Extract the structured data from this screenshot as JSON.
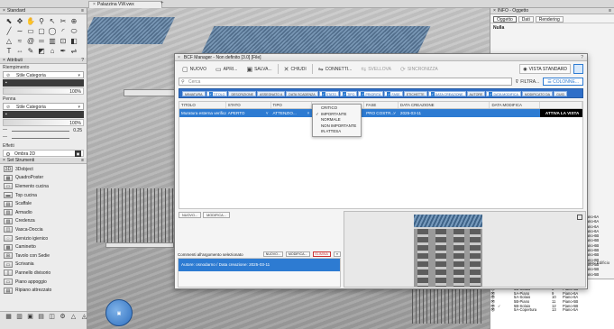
{
  "top": {
    "doc_tab_title": "Palazzina VW.vwx",
    "doc_tab_close": "×",
    "add_tab": "+"
  },
  "left": {
    "standard": {
      "title": "Standard"
    },
    "tools_row_icons": [
      "arrow-icon",
      "move-icon",
      "pan-icon",
      "zoom-icon",
      "flyover-icon",
      "close-icon",
      "3d-icon"
    ],
    "attributes": {
      "title": "Attributi",
      "fill_label": "Riempimento",
      "fill_value": "Stile Categoria",
      "percent_a": "100%",
      "pen_label": "Penna",
      "pen_value": "Stile Categoria",
      "percent_b": "100%",
      "thickness": "0.25",
      "effects_label": "Effetti",
      "shadow_label": "Ombra 2D"
    },
    "set_tools": {
      "title": "Set Strumenti",
      "items": [
        {
          "label": "3Dobject",
          "icon": "3D"
        },
        {
          "label": "QuadroPoster",
          "icon": "▦"
        },
        {
          "label": "Elemento cucina",
          "icon": "▭"
        },
        {
          "label": "Top cucina",
          "icon": "▬"
        },
        {
          "label": "Scaffale",
          "icon": "▤"
        },
        {
          "label": "Armadio",
          "icon": "▥"
        },
        {
          "label": "Credenza",
          "icon": "▨"
        },
        {
          "label": "Vasca-Doccia",
          "icon": "◫"
        },
        {
          "label": "Servizio igienico",
          "icon": "◌"
        },
        {
          "label": "Caminetto",
          "icon": "▩"
        },
        {
          "label": "Tavolo con Sedie",
          "icon": "⊞"
        },
        {
          "label": "Scrivania",
          "icon": "▭"
        },
        {
          "label": "Pannello divisorio",
          "icon": "▯"
        },
        {
          "label": "Piano appoggio",
          "icon": "▭"
        },
        {
          "label": "Ripiano attrezzato",
          "icon": "▤"
        }
      ]
    },
    "bottom_icons": [
      "▦",
      "▥",
      "▣",
      "▤",
      "◫",
      "⚙",
      "△",
      "◬"
    ]
  },
  "right": {
    "title": "INFO - Oggetto",
    "tabs": [
      "Oggetto",
      "Dati",
      "Rendering"
    ],
    "none_label": "Nulla",
    "side_label": "Piano Edificio",
    "stories": [
      "Piano-6A",
      "Piano-6A",
      "Piano-6A",
      "Piano-6A",
      "Piano-6B",
      "Piano-6B",
      "Piano-6B",
      "Piano-6B",
      "Piano-6B",
      "Piano-6B",
      "Piano-5B",
      "Piano-5B",
      "Piano-5B"
    ],
    "sheet_rows": [
      {
        "name": "5B-Copertura",
        "n": "6",
        "story": "Piano-6B"
      },
      {
        "name": "5B-Piano",
        "n": "7",
        "story": "Piano-6B"
      },
      {
        "name": "5B-Solaio",
        "n": "8",
        "story": "Piano-6B"
      },
      {
        "name": "5A-Piano",
        "n": "9",
        "story": "Piano-6A"
      },
      {
        "name": "5A-Solaio",
        "n": "10",
        "story": "Piano-6A"
      },
      {
        "name": "5B-Piano",
        "n": "11",
        "story": "Piano-5B"
      },
      {
        "name": "5B-Solaio",
        "n": "12",
        "story": "Piano-5B"
      },
      {
        "name": "5A-Copertura",
        "n": "13",
        "story": "Piano-5A"
      }
    ]
  },
  "dialog": {
    "title": "BCF Manager - Non definito [3.0] [File]",
    "help": "?",
    "toolbar": [
      {
        "label": "NUOVO",
        "icon": "▢",
        "enabled": true
      },
      {
        "label": "APRI...",
        "icon": "▭",
        "enabled": true
      },
      {
        "label": "SALVA...",
        "icon": "▣",
        "enabled": true
      },
      {
        "label": "CHIUDI",
        "icon": "✕",
        "enabled": true
      },
      {
        "label": "CONNETTI...",
        "icon": "⇋",
        "enabled": true
      },
      {
        "label": "SVELLOVA",
        "icon": "⇆",
        "enabled": false
      },
      {
        "label": "SINCRONIZZA",
        "icon": "⟳",
        "enabled": false
      }
    ],
    "vista_label": "VISTA STANDARD",
    "search_placeholder": "Cerca",
    "filter_label": "FILTRA...",
    "columns_label": "COLONNE...",
    "column_toggles": [
      {
        "label": "MINIATURA",
        "on": false
      },
      {
        "label": "TITOLO",
        "on": true
      },
      {
        "label": "DESCRIZIONE",
        "on": false
      },
      {
        "label": "ASSEGNATO A",
        "on": false
      },
      {
        "label": "DATA SCADENZA",
        "on": false
      },
      {
        "label": "STATO",
        "on": true
      },
      {
        "label": "TIPO",
        "on": true
      },
      {
        "label": "PRIORITÀ",
        "on": true
      },
      {
        "label": "FASE",
        "on": true
      },
      {
        "label": "ETICHETTE",
        "on": false
      },
      {
        "label": "DATA CREAZIONE",
        "on": true
      },
      {
        "label": "AUTORE",
        "on": false
      },
      {
        "label": "DATA MODIFICA",
        "on": true
      },
      {
        "label": "MODIFICATO DA",
        "on": false
      },
      {
        "label": "GUID",
        "on": false
      }
    ],
    "table": {
      "headers": [
        "TITOLO",
        "STATO",
        "TIPO",
        "",
        "FASE",
        "DATA CREAZIONE",
        "DATA MODIFICA",
        ""
      ],
      "row": {
        "title": "Muratura esterna verifica",
        "status": "APERTO",
        "type": "ATTENZIO...",
        "phase": "PRO COSTR...",
        "created": "2025-03-11",
        "modified": "",
        "action": "ATTIVA LA VISTA"
      }
    },
    "priority_menu": {
      "items": [
        "CRITICO",
        "IMPORTANTE",
        "NORMALE",
        "NON IMPORTANTE",
        "IN ATTESA"
      ],
      "checked_index": 1
    },
    "lower_tabs": [
      "NUOVO...",
      "MODIFICA..."
    ],
    "comments": {
      "label": "Commenti all'argomento selezionato",
      "buttons": [
        "NUOVO...",
        "MODIFICA...",
        "ELIMINA"
      ],
      "item": "Autore: osnodarno / Data creazione: 2025-03-11"
    }
  }
}
